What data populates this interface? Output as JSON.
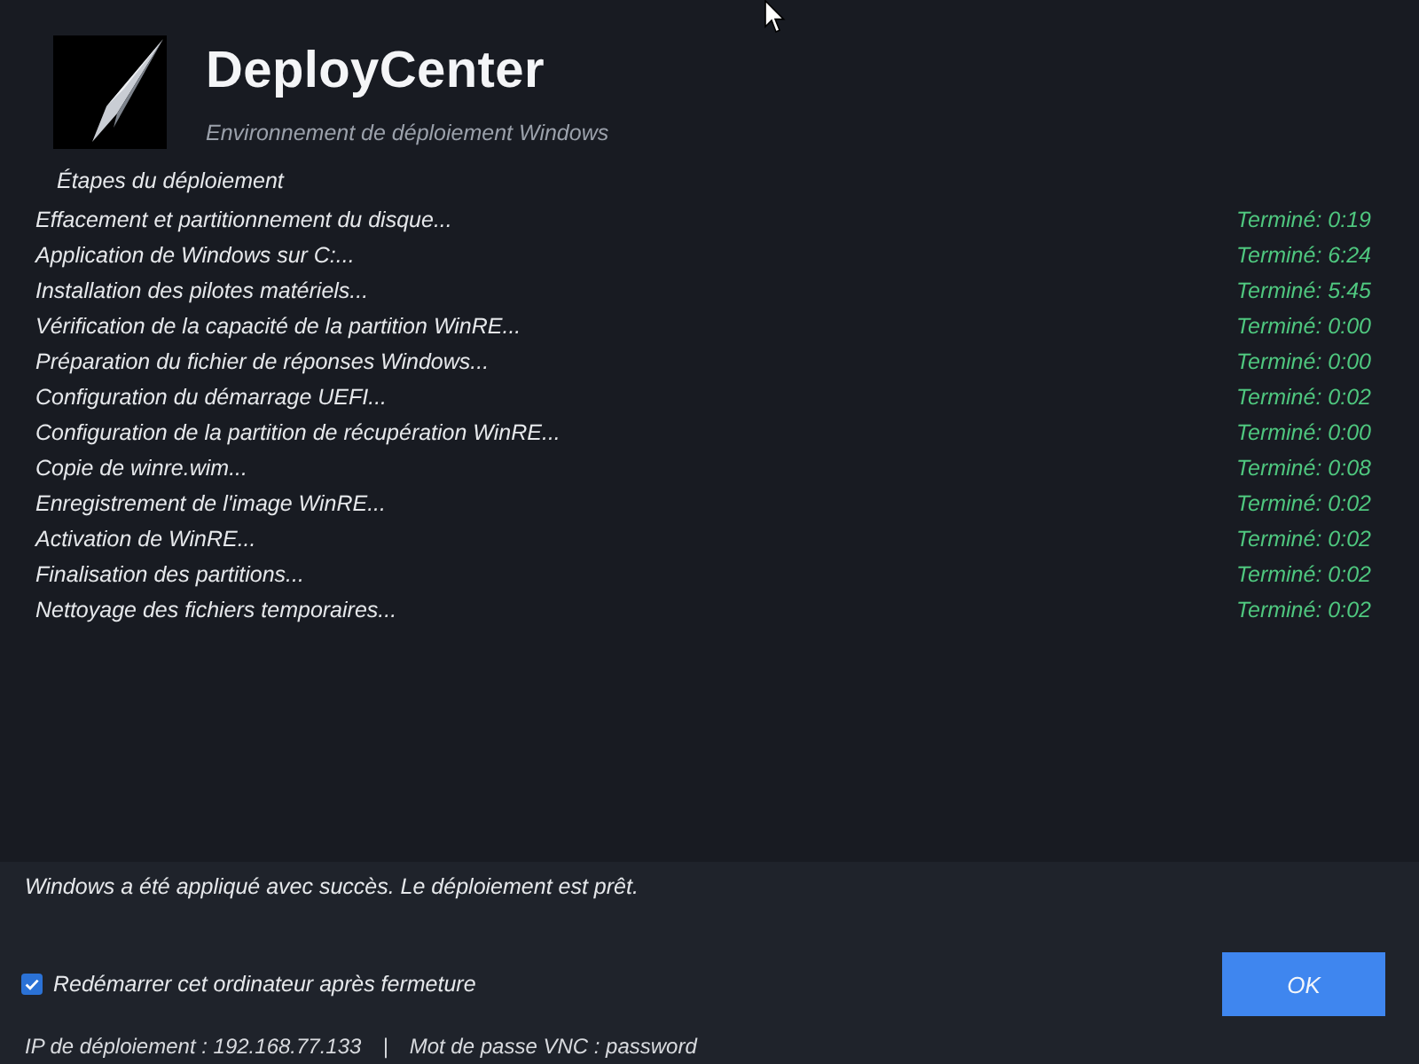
{
  "header": {
    "title": "DeployCenter",
    "subtitle": "Environnement de déploiement Windows"
  },
  "steps": {
    "heading": "Étapes du déploiement",
    "items": [
      {
        "label": "Effacement et partitionnement du disque...",
        "status": "Terminé: 0:19"
      },
      {
        "label": "Application de Windows sur C:...",
        "status": "Terminé: 6:24"
      },
      {
        "label": "Installation des pilotes matériels...",
        "status": "Terminé: 5:45"
      },
      {
        "label": "Vérification de la capacité de la partition WinRE...",
        "status": "Terminé: 0:00"
      },
      {
        "label": "Préparation du fichier de réponses Windows...",
        "status": "Terminé: 0:00"
      },
      {
        "label": "Configuration du démarrage UEFI...",
        "status": "Terminé: 0:02"
      },
      {
        "label": "Configuration de la partition de récupération WinRE...",
        "status": "Terminé: 0:00"
      },
      {
        "label": "Copie de winre.wim...",
        "status": "Terminé: 0:08"
      },
      {
        "label": "Enregistrement de l'image WinRE...",
        "status": "Terminé: 0:02"
      },
      {
        "label": "Activation de WinRE...",
        "status": "Terminé: 0:02"
      },
      {
        "label": "Finalisation des partitions...",
        "status": "Terminé: 0:02"
      },
      {
        "label": "Nettoyage des fichiers temporaires...",
        "status": "Terminé: 0:02"
      }
    ]
  },
  "footer": {
    "message": "Windows a été appliqué avec succès. Le déploiement est prêt.",
    "restart_option": {
      "label": "Redémarrer cet ordinateur après fermeture",
      "checked": true
    },
    "ok_button": "OK",
    "info": [
      "IP de déploiement : 192.168.77.133",
      "|",
      "Mot de passe VNC : password"
    ]
  }
}
